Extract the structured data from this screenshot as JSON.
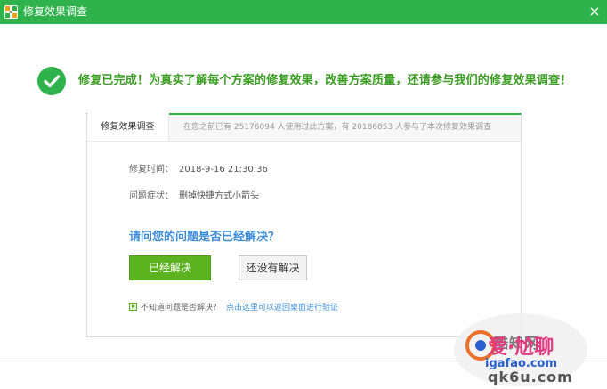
{
  "window": {
    "title": "修复效果调查",
    "close_glyph": "×",
    "accent_color": "#2fb24c"
  },
  "status": {
    "icon": "checkmark-icon",
    "message": "修复已完成！为真实了解每个方案的修复效果，改善方案质量，还请参与我们的修复效果调查！"
  },
  "survey_card": {
    "tab_label": "修复效果调查",
    "stats_text": "在您之前已有 25176094 人使用过此方案，有 20186853 人参与了本次修复效果调查",
    "repair_time_label": "修复时间：",
    "repair_time_value": "2018-9-16 21:30:36",
    "symptom_label": "问题症状：",
    "symptom_value": "删掉快捷方式小箭头",
    "question": "请问您的问题是否已经解决？",
    "resolved_button": "已经解决",
    "unresolved_button": "还没有解决",
    "help_text": "不知道问题是否解决？",
    "help_link": "点击这里可以返回桌面进行验证"
  },
  "watermark": {
    "text1": "酷知网",
    "text2": "爱·尬聊",
    "url": "igafao.com",
    "text3": "qk6u.com"
  }
}
